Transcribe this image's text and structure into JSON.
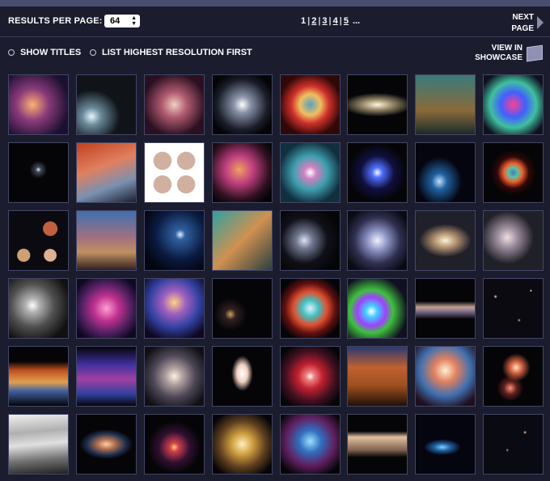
{
  "toolbar": {
    "results_per_page_label": "RESULTS PER PAGE:",
    "results_per_page_value": "64",
    "pages": [
      "1",
      "2",
      "3",
      "4",
      "5"
    ],
    "ellipsis": "...",
    "current_page": "1",
    "next_page_line1": "NEXT",
    "next_page_line2": "PAGE"
  },
  "options": {
    "show_titles_label": "SHOW TITLES",
    "highest_res_label": "LIST HIGHEST RESOLUTION FIRST",
    "view_in_line1": "VIEW IN",
    "view_in_line2": "SHOWCASE"
  },
  "colors": {
    "background": "#1b1c2e",
    "border": "#444766",
    "accent": "#4a4c70"
  },
  "thumbnails": [
    {
      "name": "star-cluster-nebula",
      "bg": "radial-gradient(circle at 40% 50%, #ffb070 0%, #8a3a7a 35%, #1a1030 80%)",
      "shape": "full"
    },
    {
      "name": "comet",
      "bg": "radial-gradient(ellipse at 25% 70%, #e8f4ff 0%, #6a8a9a 15%, #101418 45%)",
      "shape": "full"
    },
    {
      "name": "orion-nebula",
      "bg": "radial-gradient(circle at 50% 50%, #f0d0c0 0%, #b05a70 30%, #2a1020 75%)",
      "shape": "full"
    },
    {
      "name": "spiral-galaxy",
      "bg": "radial-gradient(circle at 50% 50%, #ffffff 0%, #8a92a8 20%, #1a1e2a 60%, #050507 80%)",
      "shape": "full"
    },
    {
      "name": "helix-nebula",
      "bg": "radial-gradient(circle at 50% 50%, #5aa0c0 0%, #f0c060 25%, #d0302a 45%, #300808 75%)",
      "shape": "full"
    },
    {
      "name": "sombrero-galaxy",
      "bg": "radial-gradient(ellipse 60% 20% at 50% 50%, #fff6e0 0%, #a09070 40%, #050507 100%)",
      "shape": "full"
    },
    {
      "name": "pillars-of-creation",
      "bg": "linear-gradient(180deg, #3a7a7a 0%, #8a6a3a 60%, #1a2a2a 100%)",
      "shape": "full"
    },
    {
      "name": "colliding-galaxies",
      "bg": "radial-gradient(circle at 50% 50%, #ff4090 0%, #4060ff 30%, #40c0a0 55%, #101020 85%)",
      "shape": "full"
    },
    {
      "name": "small-comet",
      "bg": "radial-gradient(circle at 50% 45%, #e0e8f0 0%, #404858 6%, #050507 20%)",
      "shape": "full"
    },
    {
      "name": "horsehead-nebula",
      "bg": "linear-gradient(160deg, #c04020 0%, #e08060 40%, #7a90b0 70%, #1a2030 100%)",
      "shape": "full"
    },
    {
      "name": "jupiter-grid",
      "bg": "radial-gradient(circle at 30% 30%, #d0b0a0 0%, #d0b0a0 15%, transparent 16%), radial-gradient(circle at 70% 30%, #d0b0a0 0%, #d0b0a0 15%, transparent 16%), radial-gradient(circle at 30% 70%, #d0b0a0 0%, #d0b0a0 15%, transparent 16%), radial-gradient(circle at 70% 70%, #d0b0a0 0%, #d0b0a0 15%, transparent 16%), #ffffff",
      "shape": "full"
    },
    {
      "name": "interacting-galaxy-pair",
      "bg": "radial-gradient(circle at 45% 45%, #f0a060 0%, #c04080 30%, #301020 65%, #050507 85%)",
      "shape": "full"
    },
    {
      "name": "cats-eye-nebula",
      "bg": "radial-gradient(circle at 50% 50%, #ffffff 0%, #d080c0 15%, #40a0b0 40%, #103040 75%)",
      "shape": "full"
    },
    {
      "name": "planetary-nebula-blue",
      "bg": "radial-gradient(circle at 50% 50%, #ffffff 0%, #5070ff 12%, #101040 40%, #050507 70%)",
      "shape": "full"
    },
    {
      "name": "blue-comet",
      "bg": "radial-gradient(ellipse at 40% 65%, #c0e0ff 0%, #2060a0 15%, #050510 45%)",
      "shape": "full"
    },
    {
      "name": "ring-nebula",
      "bg": "radial-gradient(circle at 50% 50%, #4080c0 0%, #60c0a0 12%, #f06030 22%, #300808 38%, #050507 55%)",
      "shape": "full"
    },
    {
      "name": "solar-system-collage",
      "bg": "radial-gradient(circle at 25% 75%, #d0a070 0%, #d0a070 10%, transparent 11%), radial-gradient(circle at 70% 30%, #c06040 0%, #c06040 12%, transparent 13%), radial-gradient(circle at 70% 75%, #e0b090 0%, #e0b090 10%, transparent 11%), #0a0a10",
      "shape": "full"
    },
    {
      "name": "carina-mountain",
      "bg": "linear-gradient(180deg, #4070b0 0%, #a07080 45%, #c09060 70%, #302020 100%)",
      "shape": "full"
    },
    {
      "name": "comet-blue-field",
      "bg": "radial-gradient(circle at 60% 40%, #e0f0ff 0%, #3060a0 10%, #0a1a40 50%, #050510 80%)",
      "shape": "full"
    },
    {
      "name": "teal-nebula-mosaic",
      "bg": "linear-gradient(135deg, #30a0a0 0%, #d09050 50%, #2a4040 100%)",
      "shape": "full"
    },
    {
      "name": "interacting-spirals",
      "bg": "radial-gradient(circle at 40% 50%, #e0e0f0 0%, #707890 18%, #101018 50%, #050507 80%)",
      "shape": "full"
    },
    {
      "name": "whirlpool-mosaic",
      "bg": "radial-gradient(circle at 50% 50%, #f0f0ff 0%, #8a90c0 25%, #303050 55%, #0a0a14 85%)",
      "shape": "full"
    },
    {
      "name": "edge-spiral-galaxy",
      "bg": "radial-gradient(ellipse 55% 35% at 50% 50%, #fff0d0 0%, #b09070 35%, #20202a 80%)",
      "shape": "full"
    },
    {
      "name": "m51-galaxy-pair",
      "bg": "radial-gradient(circle at 40% 45%, #f0e0e0 0%, #a090a0 20%, #202028 55%), radial-gradient(circle at 80% 45%, #f0d0b0 0%, #a08070 12%, transparent 25%)",
      "shape": "full"
    },
    {
      "name": "grayscale-galaxy-mosaic",
      "bg": "radial-gradient(circle at 40% 45%, #ffffff 0%, #b0b0b0 15%, #505050 45%, #101010 80%)",
      "shape": "full"
    },
    {
      "name": "pink-nebula",
      "bg": "radial-gradient(circle at 50% 50%, #ffa0d0 0%, #c03090 30%, #502060 60%, #100820 85%)",
      "shape": "full"
    },
    {
      "name": "purple-star-cluster",
      "bg": "radial-gradient(circle at 50% 40%, #ffd080 0%, #a060c0 25%, #3040a0 55%, #100820 85%)",
      "shape": "full"
    },
    {
      "name": "deep-field",
      "bg": "radial-gradient(circle at 30% 60%, #d0a060 0%, #302020 10%, #050507 30%), radial-gradient(circle at 70% 30%, #a0a0d0 0%, transparent 8%), #050507",
      "shape": "full"
    },
    {
      "name": "crab-nebula",
      "bg": "radial-gradient(circle at 50% 50%, #e0f0ff 0%, #40c0c0 20%, #e05030 40%, #601010 60%, #050507 80%)",
      "shape": "full"
    },
    {
      "name": "rainbow-nebula",
      "bg": "radial-gradient(circle at 40% 55%, #ffffff 0%, #40d0ff 12%, #a040ff 30%, #40c040 45%, #101020 75%)",
      "shape": "full"
    },
    {
      "name": "edge-on-galaxy-band",
      "bg": "linear-gradient(180deg, #050507 0%, #050507 38%, #c0a090 48%, #807090 55%, #050507 68%, #050507 100%)",
      "shape": "full"
    },
    {
      "name": "dense-star-field",
      "bg": "radial-gradient(circle at 20% 30%, #ffe0a0 0%, transparent 3%), radial-gradient(circle at 60% 70%, #a0c0ff 0%, transparent 3%), radial-gradient(circle at 80% 20%, #ffffff 0%, transparent 2%), #0a0a10",
      "shape": "full"
    },
    {
      "name": "tarantula-wide",
      "bg": "linear-gradient(180deg, #050507 0%, #050507 25%, #c05020 40%, #e0a050 60%, #4060a0 75%, #050507 100%)",
      "shape": "full"
    },
    {
      "name": "purple-band-nebula",
      "bg": "linear-gradient(180deg, #050507 0%, #4030a0 30%, #a040a0 55%, #3040a0 80%, #050507 100%)",
      "shape": "full"
    },
    {
      "name": "face-on-spiral",
      "bg": "radial-gradient(circle at 50% 50%, #fff0e0 0%, #b0a0a0 20%, #504858 50%, #101014 85%)",
      "shape": "full"
    },
    {
      "name": "hourglass-nebula",
      "bg": "radial-gradient(ellipse 18% 30% at 50% 45%, #ffffff 0%, #f0d0c0 50%, transparent 100%), #050507",
      "shape": "full"
    },
    {
      "name": "v838-monocerotis",
      "bg": "radial-gradient(circle at 50% 50%, #ffffff 0%, #f08080 10%, #c02030 30%, #401020 60%, #050507 85%)",
      "shape": "full"
    },
    {
      "name": "eagle-pillar-tall",
      "bg": "linear-gradient(180deg, #2a3a70 0%, #c06030 35%, #a05020 65%, #201008 100%)",
      "shape": "full"
    },
    {
      "name": "star-forming-region",
      "bg": "radial-gradient(circle at 50% 40%, #fff0d0 0%, #e08060 25%, #4070b0 55%, #201020 85%)",
      "shape": "full"
    },
    {
      "name": "arp-galaxy-pair",
      "bg": "radial-gradient(circle at 55% 35%, #ffe0c0 0%, #d06040 12%, transparent 28%), radial-gradient(circle at 45% 70%, #ff9070 0%, #602020 12%, transparent 25%), #050507",
      "shape": "full"
    },
    {
      "name": "jupiter-closeup",
      "bg": "linear-gradient(175deg, #f0f0f0 0%, #b0b0b0 30%, #e0e0e0 50%, #707070 75%, #202020 100%)",
      "shape": "full"
    },
    {
      "name": "tilted-spiral-galaxy",
      "bg": "radial-gradient(ellipse 50% 28% at 50% 50%, #ffd0a0 0%, #b07050 30%, #203050 65%, #050507 90%)",
      "shape": "full"
    },
    {
      "name": "glowing-core-galaxy",
      "bg": "radial-gradient(circle at 50% 55%, #ffd060 0%, #d04050 10%, #301030 35%, #050507 60%)",
      "shape": "full"
    },
    {
      "name": "globular-cluster",
      "bg": "radial-gradient(circle at 50% 50%, #fff0c0 0%, #d0a040 25%, #604020 55%, #050507 85%)",
      "shape": "full"
    },
    {
      "name": "blue-star-nursery",
      "bg": "radial-gradient(circle at 50% 45%, #a0e0ff 0%, #3070c0 25%, #602060 55%, #050507 85%)",
      "shape": "full"
    },
    {
      "name": "mars-surface-strip",
      "bg": "linear-gradient(180deg, #050507 0%, #050507 28%, #e0c0a0 38%, #806050 60%, #050507 72%, #050507 100%)",
      "shape": "full"
    },
    {
      "name": "blue-galaxy-jet",
      "bg": "radial-gradient(ellipse 35% 15% at 45% 55%, #80d0ff 0%, #2060a0 40%, #050510 90%)",
      "shape": "full"
    },
    {
      "name": "dim-mosaic-field",
      "bg": "radial-gradient(circle at 40% 60%, #c0c0d0 0%, transparent 3%), radial-gradient(circle at 70% 30%, #ffd0a0 0%, transparent 3%), #0a0a12",
      "shape": "full"
    }
  ]
}
